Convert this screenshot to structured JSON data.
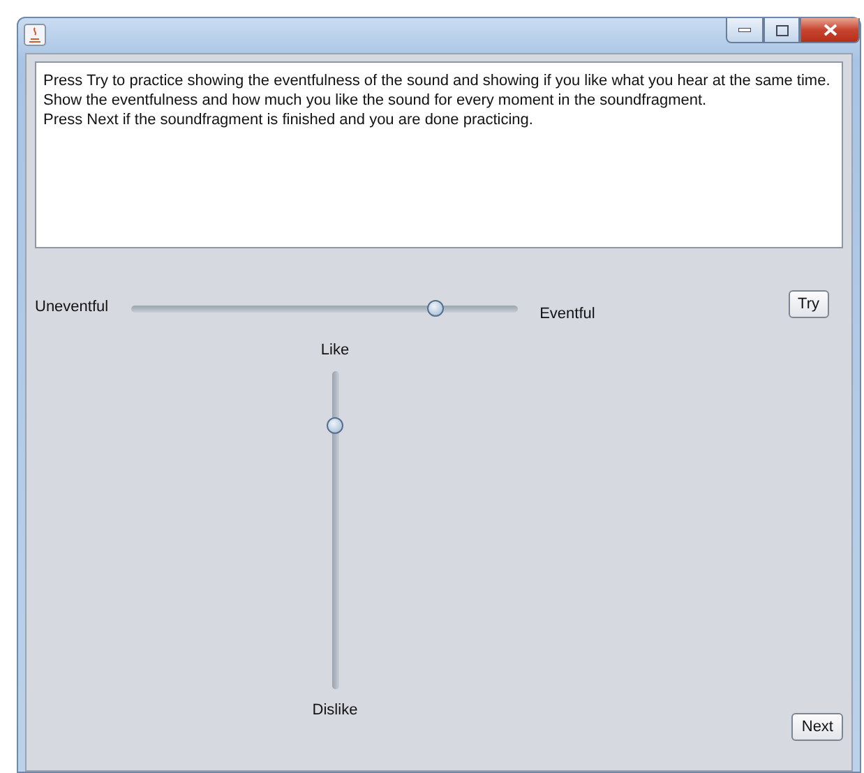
{
  "instructions": [
    "Press Try to practice showing the eventfulness of the sound and showing if you like what you hear at the same time.",
    "Show the eventfulness and how much you like the sound for every moment in the soundfragment.",
    "Press Next if the soundfragment is finished and you are done practicing."
  ],
  "eventfulness": {
    "min_label": "Uneventful",
    "max_label": "Eventful",
    "level": 0.79
  },
  "try_button": "Try",
  "liking": {
    "max_label": "Like",
    "min_label": "Dislike",
    "level": 0.83
  },
  "next_button": "Next"
}
